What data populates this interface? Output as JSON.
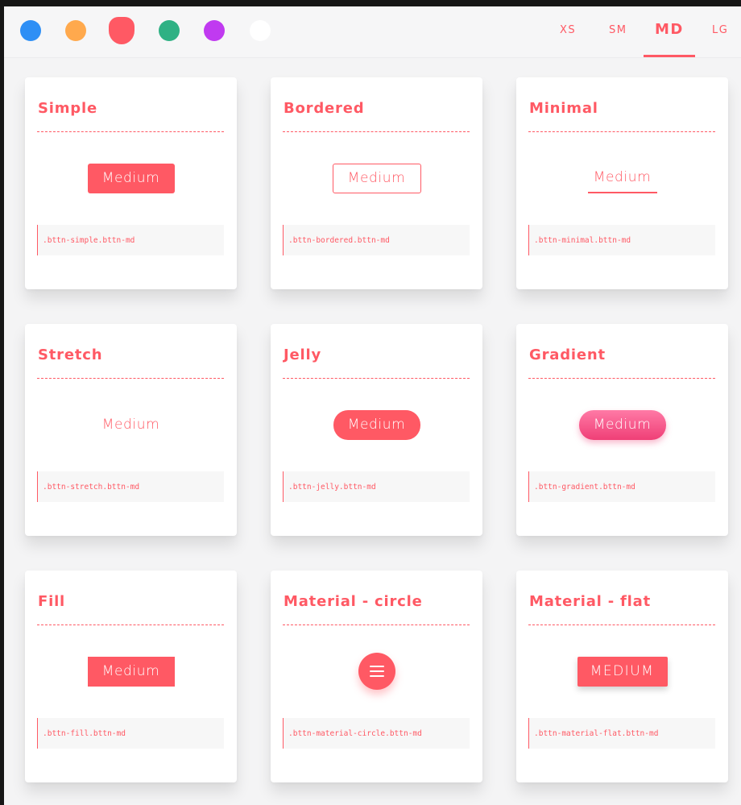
{
  "toolbar": {
    "colors": [
      {
        "name": "blue",
        "hex": "#2e8ff5"
      },
      {
        "name": "orange",
        "hex": "#ffa94d"
      },
      {
        "name": "red",
        "hex": "#ff5964",
        "selected": true
      },
      {
        "name": "green",
        "hex": "#2fb184"
      },
      {
        "name": "purple",
        "hex": "#c03af0"
      },
      {
        "name": "white",
        "hex": "#ffffff"
      }
    ],
    "sizes": [
      {
        "label": "XS",
        "selected": false
      },
      {
        "label": "SM",
        "selected": false
      },
      {
        "label": "MD",
        "selected": true
      },
      {
        "label": "LG",
        "selected": false
      }
    ]
  },
  "accent": "#ff5964",
  "cards": [
    {
      "title": "Simple",
      "button_label": "Medium",
      "code": ".bttn-simple.bttn-md"
    },
    {
      "title": "Bordered",
      "button_label": "Medium",
      "code": ".bttn-bordered.bttn-md"
    },
    {
      "title": "Minimal",
      "button_label": "Medium",
      "code": ".bttn-minimal.bttn-md"
    },
    {
      "title": "Stretch",
      "button_label": "Medium",
      "code": ".bttn-stretch.bttn-md"
    },
    {
      "title": "Jelly",
      "button_label": "Medium",
      "code": ".bttn-jelly.bttn-md"
    },
    {
      "title": "Gradient",
      "button_label": "Medium",
      "code": ".bttn-gradient.bttn-md"
    },
    {
      "title": "Fill",
      "button_label": "Medium",
      "code": ".bttn-fill.bttn-md"
    },
    {
      "title": "Material - circle",
      "button_icon": "menu-icon",
      "code": ".bttn-material-circle.bttn-md"
    },
    {
      "title": "Material - flat",
      "button_label": "MEDIUM",
      "code": ".bttn-material-flat.bttn-md"
    }
  ]
}
